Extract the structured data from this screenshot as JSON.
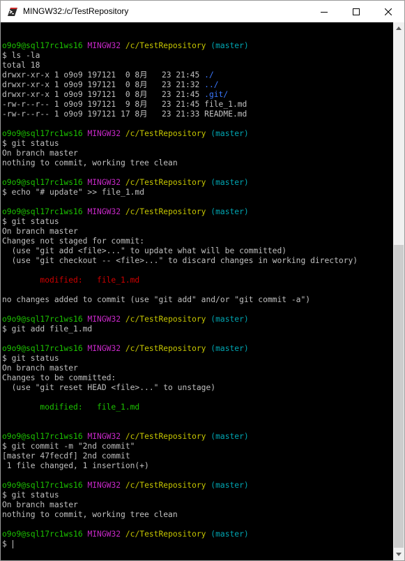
{
  "window": {
    "title": "MINGW32:/c/TestRepository",
    "minimize_icon": "minimize-icon",
    "maximize_icon": "maximize-icon",
    "close_icon": "close-icon"
  },
  "colors": {
    "background": "#000000",
    "text": "#c0c0c0",
    "user_host": "#1cc300",
    "system": "#c728c7",
    "path": "#c6c600",
    "branch": "#00a6b2",
    "directory": "#3b78ff",
    "modified_unstaged": "#d00000",
    "modified_staged": "#1cc300"
  },
  "terminal": {
    "lines": [
      [],
      [
        {
          "t": "o9o9@sql17rc1ws16 ",
          "c": "green"
        },
        {
          "t": "MINGW32 ",
          "c": "magenta"
        },
        {
          "t": "/c/TestRepository ",
          "c": "yellow"
        },
        {
          "t": "(master)",
          "c": "cyan"
        }
      ],
      [
        {
          "t": "$ ls -la",
          "c": "text"
        }
      ],
      [
        {
          "t": "total 18",
          "c": "text"
        }
      ],
      [
        {
          "t": "drwxr-xr-x 1 o9o9 197121  0 8月   23 21:45 ",
          "c": "text"
        },
        {
          "t": "./",
          "c": "blue"
        }
      ],
      [
        {
          "t": "drwxr-xr-x 1 o9o9 197121  0 8月   23 21:32 ",
          "c": "text"
        },
        {
          "t": "../",
          "c": "blue"
        }
      ],
      [
        {
          "t": "drwxr-xr-x 1 o9o9 197121  0 8月   23 21:45 ",
          "c": "text"
        },
        {
          "t": ".git/",
          "c": "blue"
        }
      ],
      [
        {
          "t": "-rw-r--r-- 1 o9o9 197121  9 8月   23 21:45 file_1.md",
          "c": "text"
        }
      ],
      [
        {
          "t": "-rw-r--r-- 1 o9o9 197121 17 8月   23 21:33 README.md",
          "c": "text"
        }
      ],
      [],
      [
        {
          "t": "o9o9@sql17rc1ws16 ",
          "c": "green"
        },
        {
          "t": "MINGW32 ",
          "c": "magenta"
        },
        {
          "t": "/c/TestRepository ",
          "c": "yellow"
        },
        {
          "t": "(master)",
          "c": "cyan"
        }
      ],
      [
        {
          "t": "$ git status",
          "c": "text"
        }
      ],
      [
        {
          "t": "On branch master",
          "c": "text"
        }
      ],
      [
        {
          "t": "nothing to commit, working tree clean",
          "c": "text"
        }
      ],
      [],
      [
        {
          "t": "o9o9@sql17rc1ws16 ",
          "c": "green"
        },
        {
          "t": "MINGW32 ",
          "c": "magenta"
        },
        {
          "t": "/c/TestRepository ",
          "c": "yellow"
        },
        {
          "t": "(master)",
          "c": "cyan"
        }
      ],
      [
        {
          "t": "$ echo \"# update\" >> file_1.md",
          "c": "text"
        }
      ],
      [],
      [
        {
          "t": "o9o9@sql17rc1ws16 ",
          "c": "green"
        },
        {
          "t": "MINGW32 ",
          "c": "magenta"
        },
        {
          "t": "/c/TestRepository ",
          "c": "yellow"
        },
        {
          "t": "(master)",
          "c": "cyan"
        }
      ],
      [
        {
          "t": "$ git status",
          "c": "text"
        }
      ],
      [
        {
          "t": "On branch master",
          "c": "text"
        }
      ],
      [
        {
          "t": "Changes not staged for commit:",
          "c": "text"
        }
      ],
      [
        {
          "t": "  (use \"git add <file>...\" to update what will be committed)",
          "c": "text"
        }
      ],
      [
        {
          "t": "  (use \"git checkout -- <file>...\" to discard changes in working directory)",
          "c": "text"
        }
      ],
      [],
      [
        {
          "t": "        modified:   file_1.md",
          "c": "red"
        }
      ],
      [],
      [
        {
          "t": "no changes added to commit (use \"git add\" and/or \"git commit -a\")",
          "c": "text"
        }
      ],
      [],
      [
        {
          "t": "o9o9@sql17rc1ws16 ",
          "c": "green"
        },
        {
          "t": "MINGW32 ",
          "c": "magenta"
        },
        {
          "t": "/c/TestRepository ",
          "c": "yellow"
        },
        {
          "t": "(master)",
          "c": "cyan"
        }
      ],
      [
        {
          "t": "$ git add file_1.md",
          "c": "text"
        }
      ],
      [],
      [
        {
          "t": "o9o9@sql17rc1ws16 ",
          "c": "green"
        },
        {
          "t": "MINGW32 ",
          "c": "magenta"
        },
        {
          "t": "/c/TestRepository ",
          "c": "yellow"
        },
        {
          "t": "(master)",
          "c": "cyan"
        }
      ],
      [
        {
          "t": "$ git status",
          "c": "text"
        }
      ],
      [
        {
          "t": "On branch master",
          "c": "text"
        }
      ],
      [
        {
          "t": "Changes to be committed:",
          "c": "text"
        }
      ],
      [
        {
          "t": "  (use \"git reset HEAD <file>...\" to unstage)",
          "c": "text"
        }
      ],
      [],
      [
        {
          "t": "        modified:   file_1.md",
          "c": "green"
        }
      ],
      [],
      [],
      [
        {
          "t": "o9o9@sql17rc1ws16 ",
          "c": "green"
        },
        {
          "t": "MINGW32 ",
          "c": "magenta"
        },
        {
          "t": "/c/TestRepository ",
          "c": "yellow"
        },
        {
          "t": "(master)",
          "c": "cyan"
        }
      ],
      [
        {
          "t": "$ git commit -m \"2nd commit\"",
          "c": "text"
        }
      ],
      [
        {
          "t": "[master 47fecdf] 2nd commit",
          "c": "text"
        }
      ],
      [
        {
          "t": " 1 file changed, 1 insertion(+)",
          "c": "text"
        }
      ],
      [],
      [
        {
          "t": "o9o9@sql17rc1ws16 ",
          "c": "green"
        },
        {
          "t": "MINGW32 ",
          "c": "magenta"
        },
        {
          "t": "/c/TestRepository ",
          "c": "yellow"
        },
        {
          "t": "(master)",
          "c": "cyan"
        }
      ],
      [
        {
          "t": "$ git status",
          "c": "text"
        }
      ],
      [
        {
          "t": "On branch master",
          "c": "text"
        }
      ],
      [
        {
          "t": "nothing to commit, working tree clean",
          "c": "text"
        }
      ],
      [],
      [
        {
          "t": "o9o9@sql17rc1ws16 ",
          "c": "green"
        },
        {
          "t": "MINGW32 ",
          "c": "magenta"
        },
        {
          "t": "/c/TestRepository ",
          "c": "yellow"
        },
        {
          "t": "(master)",
          "c": "cyan"
        }
      ]
    ],
    "input_prompt": "$ ",
    "input_value": ""
  },
  "scrollbar": {
    "up_icon": "scroll-up-arrow-icon",
    "down_icon": "scroll-down-arrow-icon"
  }
}
